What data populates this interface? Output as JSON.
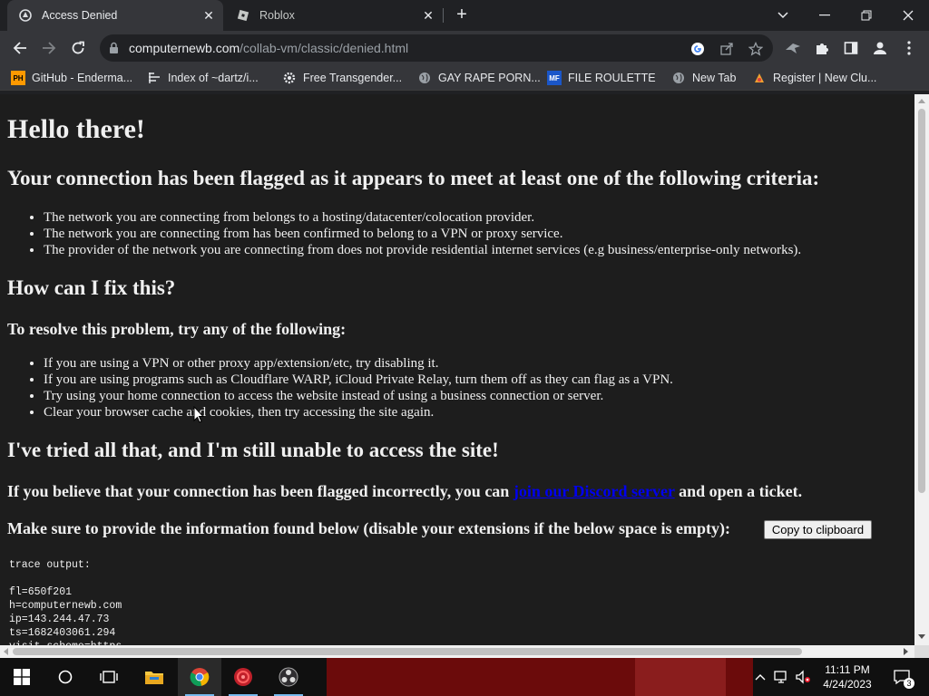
{
  "browser": {
    "tabs": [
      {
        "title": "Access Denied",
        "active": true,
        "icon": "computernewb-favicon"
      },
      {
        "title": "Roblox",
        "active": false,
        "icon": "roblox-favicon"
      }
    ],
    "url_host": "computernewb.com",
    "url_path": "/collab-vm/classic/denied.html",
    "bookmarks": [
      {
        "label": "GitHub - Enderma...",
        "icon": "PH"
      },
      {
        "label": "Index of ~dartz/i...",
        "icon": "index-icon"
      },
      {
        "label": "Free Transgender...",
        "icon": "gear-site-icon"
      },
      {
        "label": "GAY RAPE PORN...",
        "icon": "globe-icon"
      },
      {
        "label": "FILE ROULETTE",
        "icon": "MF"
      },
      {
        "label": "New Tab",
        "icon": "globe-icon"
      },
      {
        "label": "Register | New Clu...",
        "icon": "club-icon"
      }
    ]
  },
  "page": {
    "greeting": "Hello there!",
    "flagged_heading": "Your connection has been flagged as it appears to meet at least one of the following criteria:",
    "criteria": [
      "The network you are connecting from belongs to a hosting/datacenter/colocation provider.",
      "The network you are connecting from has been confirmed to belong to a VPN or proxy service.",
      "The provider of the network you are connecting from does not provide residential internet services (e.g business/enterprise-only networks)."
    ],
    "fix_heading": "How can I fix this?",
    "resolve_heading": "To resolve this problem, try any of the following:",
    "fixes": [
      "If you are using a VPN or other proxy app/extension/etc, try disabling it.",
      "If you are using programs such as Cloudflare WARP, iCloud Private Relay, turn them off as they can flag as a VPN.",
      "Try using your home connection to access the website instead of using a business connection or server.",
      "Clear your browser cache and cookies, then try accessing the site again."
    ],
    "still_heading": "I've tried all that, and I'm still unable to access the site!",
    "incorrect_prefix": "If you believe that your connection has been flagged incorrectly, you can",
    "incorrect_link": "join our Discord server",
    "incorrect_suffix": "and open a ticket.",
    "info_text": "Make sure to provide the information found below (disable your extensions if the below space is empty):",
    "copy_button": "Copy to clipboard",
    "trace_output": "trace output:\n\nfl=650f201\nh=computernewb.com\nip=143.244.47.73\nts=1682403061.294\nvisit_scheme=https"
  },
  "taskbar": {
    "time": "11:11 PM",
    "date": "4/24/2023",
    "notification_count": "3"
  }
}
